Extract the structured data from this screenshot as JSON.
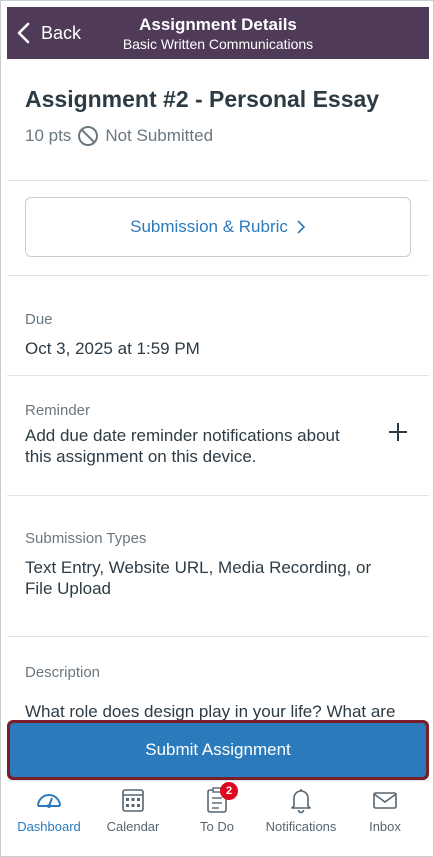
{
  "header": {
    "back_label": "Back",
    "title": "Assignment Details",
    "subtitle": "Basic Written Communications"
  },
  "assignment": {
    "title": "Assignment #2 - Personal Essay",
    "points": "10 pts",
    "status": "Not Submitted"
  },
  "rubric_button": {
    "label": "Submission & Rubric"
  },
  "due": {
    "label": "Due",
    "value": "Oct 3, 2025 at 1:59 PM"
  },
  "reminder": {
    "label": "Reminder",
    "line1": "Add due date reminder notifications about",
    "line2": "this assignment on this device."
  },
  "submission_types": {
    "label": "Submission Types",
    "line1": "Text Entry, Website URL, Media Recording, or",
    "line2": "File Upload"
  },
  "description": {
    "label": "Description",
    "text": "What role does design play in your life? What are"
  },
  "submit_button": {
    "label": "Submit Assignment"
  },
  "tabbar": {
    "items": [
      {
        "label": "Dashboard",
        "icon": "dashboard-icon",
        "active": true
      },
      {
        "label": "Calendar",
        "icon": "calendar-icon"
      },
      {
        "label": "To Do",
        "icon": "todo-icon",
        "badge": "2"
      },
      {
        "label": "Notifications",
        "icon": "bell-icon"
      },
      {
        "label": "Inbox",
        "icon": "inbox-icon"
      }
    ]
  },
  "colors": {
    "header_bg": "#4f3b58",
    "accent": "#2b7abc",
    "submit_outline": "#7a1f2a",
    "badge": "#e0061f"
  }
}
